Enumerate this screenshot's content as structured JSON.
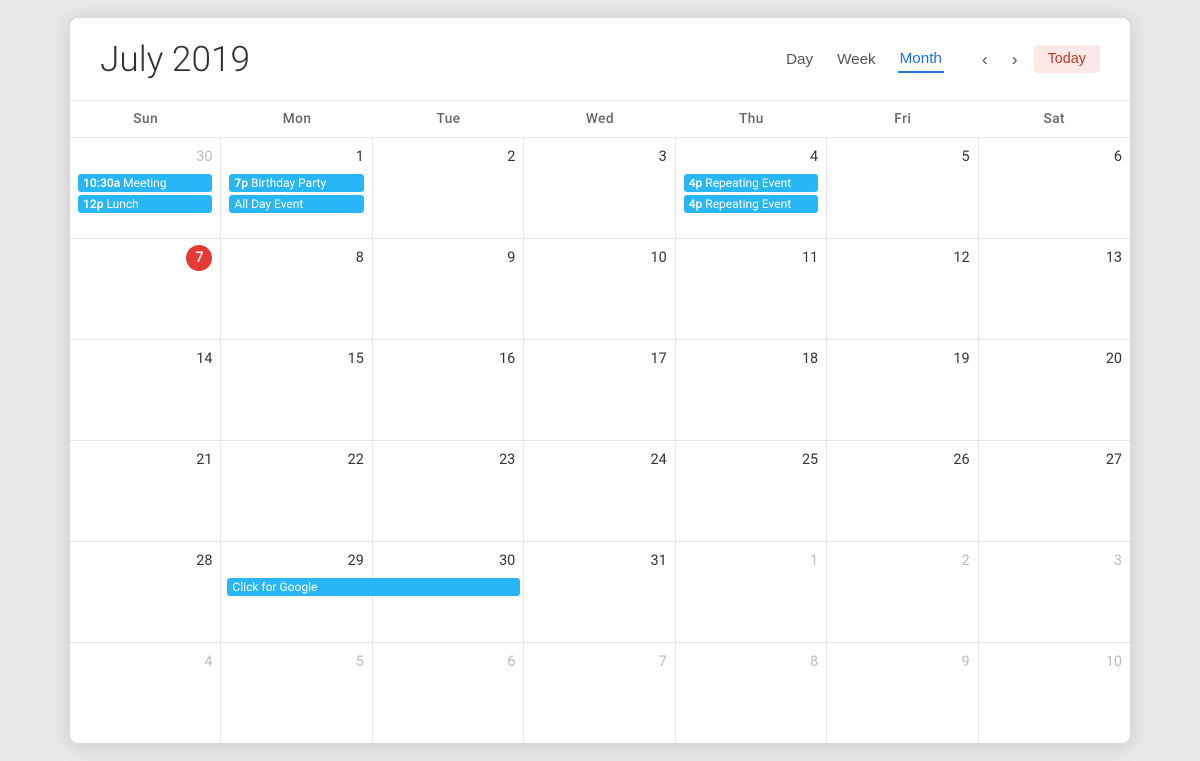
{
  "header": {
    "title": "July 2019",
    "view_day": "Day",
    "view_week": "Week",
    "view_month": "Month",
    "nav_prev": "‹",
    "nav_next": "›",
    "today_label": "Today"
  },
  "day_headers": [
    "Sun",
    "Mon",
    "Tue",
    "Wed",
    "Thu",
    "Fri",
    "Sat"
  ],
  "weeks": [
    {
      "days": [
        {
          "num": "30",
          "other": true,
          "events": [
            {
              "time": "10:30a",
              "label": "Meeting",
              "type": "event"
            },
            {
              "time": "12p",
              "label": "Lunch",
              "type": "event"
            }
          ]
        },
        {
          "num": "1",
          "other": false,
          "events": [
            {
              "time": "7p",
              "label": "Birthday Party",
              "type": "event"
            },
            {
              "label": "All Day Event",
              "type": "allday"
            }
          ]
        },
        {
          "num": "2",
          "other": false,
          "events": []
        },
        {
          "num": "3",
          "other": false,
          "events": []
        },
        {
          "num": "4",
          "other": false,
          "events": [
            {
              "time": "4p",
              "label": "Repeating Event",
              "type": "event"
            },
            {
              "time": "4p",
              "label": "Repeating Event",
              "type": "event"
            }
          ]
        },
        {
          "num": "5",
          "other": false,
          "events": []
        },
        {
          "num": "6",
          "other": false,
          "events": []
        }
      ]
    },
    {
      "days": [
        {
          "num": "7",
          "today": true,
          "events": []
        },
        {
          "num": "8",
          "other": false,
          "events": []
        },
        {
          "num": "9",
          "other": false,
          "events": []
        },
        {
          "num": "10",
          "other": false,
          "events": []
        },
        {
          "num": "11",
          "other": false,
          "events": []
        },
        {
          "num": "12",
          "other": false,
          "events": []
        },
        {
          "num": "13",
          "other": false,
          "events": []
        }
      ]
    },
    {
      "days": [
        {
          "num": "14",
          "other": false,
          "events": []
        },
        {
          "num": "15",
          "other": false,
          "events": []
        },
        {
          "num": "16",
          "other": false,
          "events": []
        },
        {
          "num": "17",
          "other": false,
          "events": []
        },
        {
          "num": "18",
          "other": false,
          "events": []
        },
        {
          "num": "19",
          "other": false,
          "events": []
        },
        {
          "num": "20",
          "other": false,
          "events": []
        }
      ]
    },
    {
      "days": [
        {
          "num": "21",
          "other": false,
          "events": []
        },
        {
          "num": "22",
          "other": false,
          "events": []
        },
        {
          "num": "23",
          "other": false,
          "events": []
        },
        {
          "num": "24",
          "other": false,
          "events": []
        },
        {
          "num": "25",
          "other": false,
          "events": []
        },
        {
          "num": "26",
          "other": false,
          "events": []
        },
        {
          "num": "27",
          "other": false,
          "events": []
        }
      ]
    },
    {
      "days": [
        {
          "num": "28",
          "other": false,
          "events": []
        },
        {
          "num": "29",
          "other": false,
          "events": [
            {
              "label": "Click for Google",
              "type": "wide",
              "span": 2
            }
          ]
        },
        {
          "num": "30",
          "other": false,
          "events": []
        },
        {
          "num": "31",
          "other": false,
          "events": []
        },
        {
          "num": "1",
          "other": true,
          "events": []
        },
        {
          "num": "2",
          "other": true,
          "events": []
        },
        {
          "num": "3",
          "other": true,
          "events": []
        }
      ]
    },
    {
      "days": [
        {
          "num": "4",
          "other": true,
          "events": []
        },
        {
          "num": "5",
          "other": true,
          "events": []
        },
        {
          "num": "6",
          "other": true,
          "events": []
        },
        {
          "num": "7",
          "other": true,
          "events": []
        },
        {
          "num": "8",
          "other": true,
          "events": []
        },
        {
          "num": "9",
          "other": true,
          "events": []
        },
        {
          "num": "10",
          "other": true,
          "events": []
        }
      ]
    }
  ]
}
